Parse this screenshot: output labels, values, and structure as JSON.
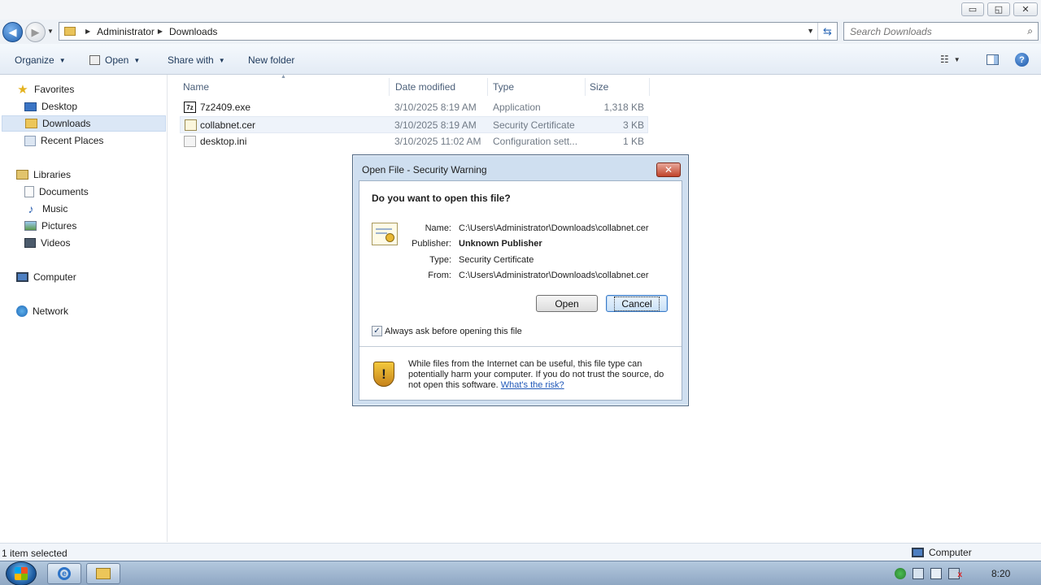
{
  "window": {
    "controls": {
      "minimize": "▭",
      "maximize": "◱",
      "close": "✕"
    }
  },
  "address_bar": {
    "breadcrumb": [
      "Administrator",
      "Downloads"
    ],
    "search_placeholder": "Search Downloads"
  },
  "toolbar": {
    "organize": "Organize",
    "open": "Open",
    "share_with": "Share with",
    "new_folder": "New folder"
  },
  "nav_pane": {
    "favorites": "Favorites",
    "favorites_items": [
      "Desktop",
      "Downloads",
      "Recent Places"
    ],
    "selected_item": "Downloads",
    "libraries": "Libraries",
    "libraries_items": [
      "Documents",
      "Music",
      "Pictures",
      "Videos"
    ],
    "computer": "Computer",
    "network": "Network"
  },
  "file_list": {
    "columns": [
      "Name",
      "Date modified",
      "Type",
      "Size"
    ],
    "files": [
      {
        "name": "7z2409.exe",
        "date": "3/10/2025 8:19 AM",
        "type": "Application",
        "size": "1,318 KB",
        "icon": "7z-exe-icon"
      },
      {
        "name": "collabnet.cer",
        "date": "3/10/2025 8:19 AM",
        "type": "Security Certificate",
        "size": "3 KB",
        "icon": "certificate-file-icon"
      },
      {
        "name": "desktop.ini",
        "date": "3/10/2025 11:02 AM",
        "type": "Configuration sett...",
        "size": "1 KB",
        "icon": "ini-file-icon"
      }
    ]
  },
  "dialog": {
    "title": "Open File - Security Warning",
    "question": "Do you want to open this file?",
    "fields": [
      {
        "label": "Name:",
        "value": "C:\\Users\\Administrator\\Downloads\\collabnet.cer"
      },
      {
        "label": "Publisher:",
        "value": "Unknown Publisher"
      },
      {
        "label": "Type:",
        "value": "Security Certificate"
      },
      {
        "label": "From:",
        "value": "C:\\Users\\Administrator\\Downloads\\collabnet.cer"
      }
    ],
    "open_button": "Open",
    "cancel_button": "Cancel",
    "checkbox_label": "Always ask before opening this file",
    "checkbox_checked": true,
    "warning_text": "While files from the Internet can be useful, this file type can potentially harm your computer. If you do not trust the source, do not open this software.",
    "risk_link": "What's the risk?"
  },
  "status_bar": {
    "selection": "1 item selected",
    "location": "Computer"
  },
  "taskbar": {
    "clock": "8:20"
  }
}
